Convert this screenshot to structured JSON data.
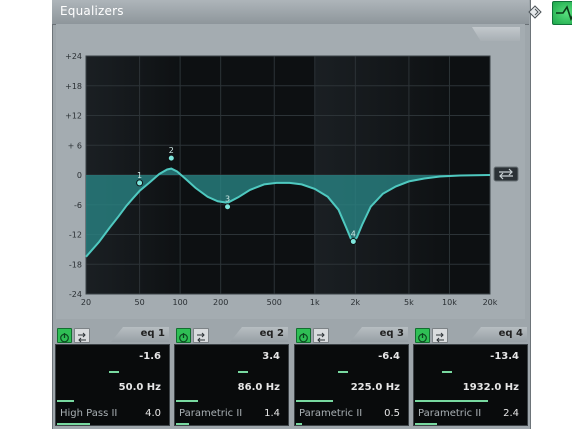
{
  "window": {
    "title": "Equalizers"
  },
  "chart_data": {
    "type": "line",
    "title": "",
    "xlabel": "",
    "ylabel": "",
    "x_scale": "log",
    "xlim": [
      20,
      20000
    ],
    "ylim": [
      -24,
      24
    ],
    "y_ticks": [
      "+24",
      "+18",
      "+12",
      "+ 6",
      "0",
      "-6",
      "-12",
      "-18",
      "-24"
    ],
    "x_ticks": [
      "20",
      "50",
      "100",
      "200",
      "500",
      "1k",
      "2k",
      "5k",
      "10k",
      "20k"
    ],
    "curve": [
      [
        20,
        -16.5
      ],
      [
        25,
        -13.5
      ],
      [
        30,
        -10.6
      ],
      [
        35,
        -8.3
      ],
      [
        40,
        -6.2
      ],
      [
        45,
        -4.6
      ],
      [
        50,
        -3.2
      ],
      [
        60,
        -1.4
      ],
      [
        70,
        0.2
      ],
      [
        80,
        1.1
      ],
      [
        86,
        1.3
      ],
      [
        95,
        0.7
      ],
      [
        110,
        -0.8
      ],
      [
        130,
        -2.6
      ],
      [
        160,
        -4.4
      ],
      [
        190,
        -5.3
      ],
      [
        225,
        -5.6
      ],
      [
        270,
        -4.5
      ],
      [
        330,
        -3.0
      ],
      [
        420,
        -1.9
      ],
      [
        520,
        -1.6
      ],
      [
        650,
        -1.6
      ],
      [
        800,
        -1.9
      ],
      [
        1000,
        -2.8
      ],
      [
        1250,
        -4.4
      ],
      [
        1500,
        -7.0
      ],
      [
        1700,
        -10.4
      ],
      [
        1850,
        -12.8
      ],
      [
        1932,
        -13.3
      ],
      [
        2050,
        -12.6
      ],
      [
        2250,
        -10.0
      ],
      [
        2600,
        -6.4
      ],
      [
        3200,
        -3.8
      ],
      [
        4000,
        -2.3
      ],
      [
        5000,
        -1.3
      ],
      [
        6500,
        -0.7
      ],
      [
        8500,
        -0.3
      ],
      [
        12000,
        -0.1
      ],
      [
        20000,
        0.0
      ]
    ],
    "nodes": [
      {
        "label": "1",
        "freq": 50,
        "gain": -1.6
      },
      {
        "label": "2",
        "freq": 86,
        "gain": 3.4
      },
      {
        "label": "3",
        "freq": 225,
        "gain": -6.4
      },
      {
        "label": "4",
        "freq": 1932,
        "gain": -13.4
      }
    ],
    "grid": true
  },
  "bands": [
    {
      "name": "eq 1",
      "gain": "-1.6",
      "freq": "50.0 Hz",
      "type": "High Pass II",
      "q": "4.0",
      "gain_level": 0.47,
      "freq_level": 0.15,
      "q_level": 0.3
    },
    {
      "name": "eq 2",
      "gain": "3.4",
      "freq": "86.0 Hz",
      "type": "Parametric II",
      "q": "1.4",
      "gain_level": 0.57,
      "freq_level": 0.2,
      "q_level": 0.12
    },
    {
      "name": "eq 3",
      "gain": "-6.4",
      "freq": "225.0 Hz",
      "type": "Parametric II",
      "q": "0.5",
      "gain_level": 0.37,
      "freq_level": 0.34,
      "q_level": 0.05
    },
    {
      "name": "eq 4",
      "gain": "-13.4",
      "freq": "1932.0 Hz",
      "type": "Parametric II",
      "q": "2.4",
      "gain_level": 0.22,
      "freq_level": 0.66,
      "q_level": 0.2
    }
  ],
  "colors": {
    "curve": "#4fc9c0",
    "fill": "#2a8a8a",
    "active_green": "#2fbf55"
  },
  "icons": {
    "preset": "preset-diamond-icon",
    "active": "eq-active-icon",
    "reset": "reset-curve-icon",
    "power": "power-icon",
    "invert": "invert-icon"
  }
}
